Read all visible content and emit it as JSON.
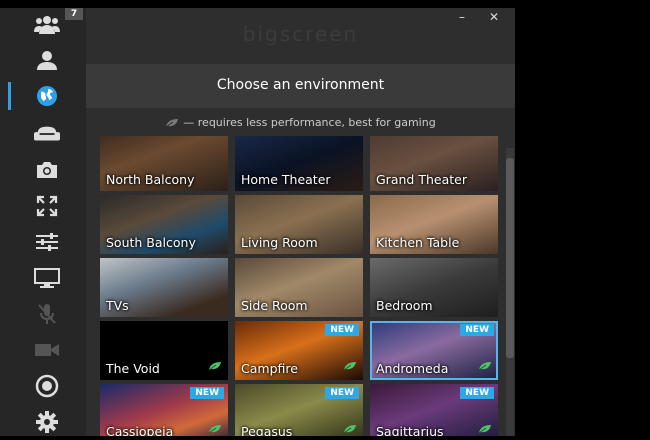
{
  "window": {
    "logo": "bigscreen",
    "minimize": "–",
    "close": "✕"
  },
  "sidebar": {
    "badge": "7",
    "items": [
      {
        "name": "sidebar-item-people",
        "icon": "people-icon"
      },
      {
        "name": "sidebar-item-profile",
        "icon": "user-icon"
      },
      {
        "name": "sidebar-item-environment",
        "icon": "globe-icon",
        "active": true
      },
      {
        "name": "sidebar-item-seat",
        "icon": "couch-icon"
      },
      {
        "name": "sidebar-item-camera",
        "icon": "camera-icon"
      },
      {
        "name": "sidebar-item-fullscreen",
        "icon": "expand-icon"
      },
      {
        "name": "sidebar-item-settings-sliders",
        "icon": "sliders-icon"
      },
      {
        "name": "sidebar-item-monitor",
        "icon": "monitor-icon"
      },
      {
        "name": "sidebar-item-mic",
        "icon": "mic-off-icon"
      },
      {
        "name": "sidebar-item-video",
        "icon": "video-camera-icon"
      },
      {
        "name": "sidebar-item-record",
        "icon": "record-icon"
      },
      {
        "name": "sidebar-item-gear",
        "icon": "gear-icon"
      }
    ]
  },
  "main": {
    "title": "Choose an environment",
    "hint": "— requires less performance, best for gaming",
    "environments": [
      {
        "label": "North Balcony",
        "new": false,
        "leaf": false
      },
      {
        "label": "Home Theater",
        "new": false,
        "leaf": false
      },
      {
        "label": "Grand Theater",
        "new": false,
        "leaf": false
      },
      {
        "label": "South Balcony",
        "new": false,
        "leaf": false
      },
      {
        "label": "Living Room",
        "new": false,
        "leaf": false
      },
      {
        "label": "Kitchen Table",
        "new": false,
        "leaf": false
      },
      {
        "label": "TVs",
        "new": false,
        "leaf": false
      },
      {
        "label": "Side Room",
        "new": false,
        "leaf": false
      },
      {
        "label": "Bedroom",
        "new": false,
        "leaf": false
      },
      {
        "label": "The Void",
        "new": false,
        "leaf": true
      },
      {
        "label": "Campfire",
        "new": true,
        "leaf": true
      },
      {
        "label": "Andromeda",
        "new": true,
        "leaf": true,
        "selected": true
      },
      {
        "label": "Cassiopeia",
        "new": true,
        "leaf": true
      },
      {
        "label": "Pegasus",
        "new": true,
        "leaf": true
      },
      {
        "label": "Sagittarius",
        "new": true,
        "leaf": true
      }
    ],
    "new_label": "NEW"
  },
  "colors": {
    "accent": "#2ea7e6",
    "leaf": "#4cc36b"
  }
}
